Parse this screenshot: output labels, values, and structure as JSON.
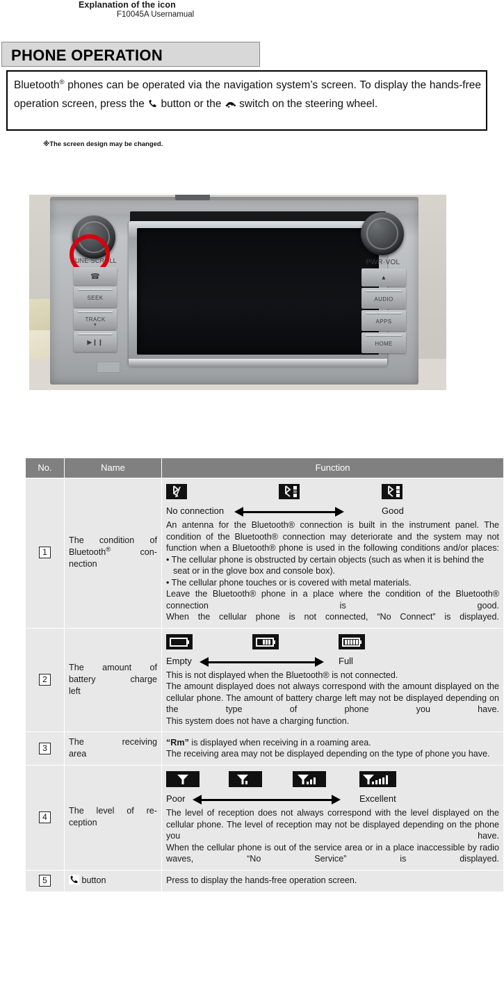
{
  "header": {
    "title": "Explanation of the icon",
    "subtitle": "F10045A Usernamual"
  },
  "section": {
    "title": "PHONE OPERATION",
    "intro_part1": "Bluetooth",
    "intro_reg": "®",
    "intro_part2": " phones can be operated via the navigation system’s screen. To display the hands-free operation screen, press the ",
    "intro_phone_icon": "phone-handset-icon",
    "intro_part3": " button or the ",
    "intro_steering_icon": "telephone-icon",
    "intro_part4": " switch on the steering wheel.",
    "note": "※The screen design may be changed."
  },
  "photo": {
    "name": "car-navigation-head-unit-photo",
    "left_knob_label": "TUNE·SCROLL",
    "right_knob_label": "PWR·VOL",
    "left_buttons": [
      "✆",
      "SEEK",
      "TRACK",
      "▶❙❙"
    ],
    "right_buttons": [
      "▲",
      "AUDIO",
      "APPS",
      "HOME"
    ],
    "highlight_color": "#d7000f"
  },
  "table": {
    "columns": [
      "No.",
      "Name",
      "Function"
    ],
    "rows": [
      {
        "no": "1",
        "name_line1": "The condition of",
        "name_line2": "Bluetooth",
        "name_reg": "®",
        "name_line3": " con-",
        "name_line4": "nection",
        "icons": {
          "type": "bluetooth",
          "items": [
            "bluetooth-no-connection-icon",
            "bluetooth-medium-icon",
            "bluetooth-good-icon"
          ]
        },
        "scale_left": "No connection",
        "scale_right": "Good",
        "paragraphs": [
          "An antenna for the Bluetooth® connection is built in the instrument panel. The condition of the Bluetooth® connection may deteriorate and the system may not function when a Bluetooth® phone is used in the following conditions and/or places:",
          "• The cellular phone is obstructed by certain objects (such as when it is behind the seat or in the glove box and console box).",
          "• The cellular phone touches or is covered with metal materials.",
          "Leave the Bluetooth® phone in a place where the condition of the Bluetooth® connection is good.",
          "When the cellular phone is not connected, “No Connect” is displayed."
        ]
      },
      {
        "no": "2",
        "name_line1": "The amount of",
        "name_line2": "battery charge",
        "name_line3": "left",
        "icons": {
          "type": "battery",
          "items": [
            "battery-empty-icon",
            "battery-half-icon",
            "battery-full-icon"
          ]
        },
        "scale_left": "Empty",
        "scale_right": "Full",
        "paragraphs": [
          "This is not displayed when the Bluetooth® is not connected.",
          "The amount displayed does not always correspond with the amount displayed on the cellular phone. The amount of battery charge left may not be displayed depending on the type of phone you have.",
          "This system does not have a charging function."
        ]
      },
      {
        "no": "3",
        "name_line1": "The receiving",
        "name_line2": "area",
        "icons": null,
        "paragraphs": [
          "“Rm” is displayed when receiving in a roaming area.",
          "The receiving area may not be displayed depending on the type of phone you have."
        ],
        "bold_lead": "“Rm”"
      },
      {
        "no": "4",
        "name_line1": "The level of re-",
        "name_line2": "ception",
        "icons": {
          "type": "signal",
          "items": [
            "signal-none-icon",
            "signal-low-icon",
            "signal-medium-icon",
            "signal-high-icon"
          ]
        },
        "scale_left": "Poor",
        "scale_right": "Excellent",
        "paragraphs": [
          "The level of reception does not always correspond with the level displayed on the cellular phone. The level of reception may not be displayed depending on the phone you have.",
          "When the cellular phone is out of the service area or in a place inaccessible by radio waves, “No Service” is displayed."
        ]
      },
      {
        "no": "5",
        "name_icon": "phone-handset-icon",
        "name_line1": " button",
        "icons": null,
        "paragraphs": [
          "Press to display the hands-free operation screen."
        ]
      }
    ]
  }
}
